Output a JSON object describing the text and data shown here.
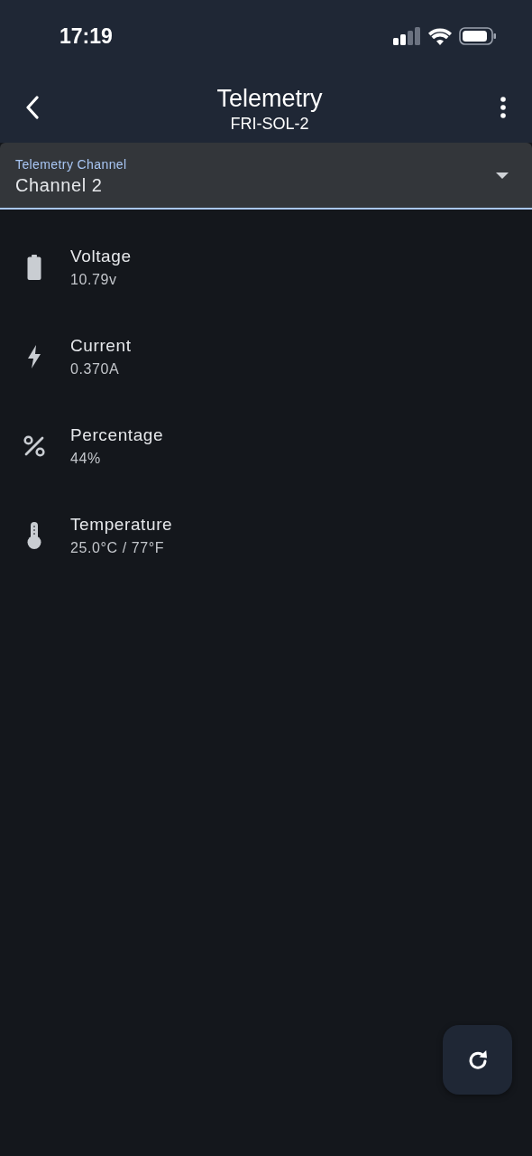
{
  "status_bar": {
    "time": "17:19"
  },
  "app_bar": {
    "title": "Telemetry",
    "subtitle": "FRI-SOL-2"
  },
  "channel_select": {
    "label": "Telemetry Channel",
    "value": "Channel 2"
  },
  "readings": [
    {
      "kind": "battery",
      "name": "Voltage",
      "value": "10.79v"
    },
    {
      "kind": "bolt",
      "name": "Current",
      "value": "0.370A"
    },
    {
      "kind": "percent",
      "name": "Percentage",
      "value": "44%"
    },
    {
      "kind": "thermometer",
      "name": "Temperature",
      "value": "25.0°C / 77°F"
    }
  ]
}
